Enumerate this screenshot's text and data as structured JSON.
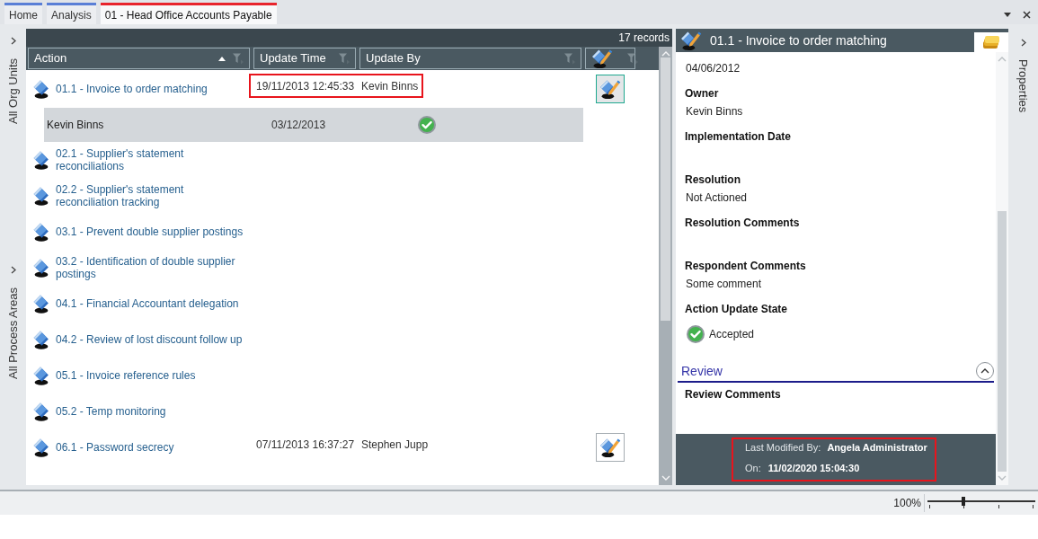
{
  "tabs": [
    {
      "label": "Home",
      "selected": false,
      "color": "#5a7fd6"
    },
    {
      "label": "Analysis",
      "selected": false,
      "color": "#5a7fd6"
    },
    {
      "label": "01 - Head Office Accounts Payable",
      "selected": true,
      "color": "#e8242c"
    }
  ],
  "left_panels": [
    {
      "label": "All Org Units"
    },
    {
      "label": "All Process Areas"
    }
  ],
  "grid": {
    "record_count": "17 records",
    "columns": [
      {
        "kind": "text",
        "label": "Action",
        "sorted": true
      },
      {
        "kind": "text",
        "label": "Update Time",
        "sorted": false
      },
      {
        "kind": "text",
        "label": "Update By",
        "sorted": false
      },
      {
        "kind": "icon",
        "sorted": false
      }
    ],
    "rows": [
      {
        "action": "01.1 - Invoice to order matching",
        "update_time": "19/11/2013 12:45:33",
        "update_by": "Kevin Binns",
        "highlighted": true,
        "edit": {
          "focused": true
        },
        "updates": [
          {
            "name": "Kevin Binns",
            "date": "03/12/2013",
            "accepted": true
          }
        ]
      },
      {
        "action": "02.1 - Supplier's statement reconciliations",
        "highlighted": false
      },
      {
        "action": "02.2 - Supplier's statement reconciliation tracking",
        "highlighted": false
      },
      {
        "action": "03.1 - Prevent double supplier postings",
        "highlighted": false
      },
      {
        "action": "03.2 - Identification of double supplier postings",
        "highlighted": false
      },
      {
        "action": "04.1 - Financial Accountant delegation",
        "highlighted": false
      },
      {
        "action": "04.2 - Review of lost discount follow up",
        "highlighted": false
      },
      {
        "action": "05.1 - Invoice reference rules",
        "highlighted": false
      },
      {
        "action": "05.2 - Temp monitoring",
        "highlighted": false
      },
      {
        "action": "06.1 - Password secrecy",
        "update_time": "07/11/2013 16:37:27",
        "update_by": "Stephen Jupp",
        "highlighted": false,
        "edit": {
          "focused": false
        }
      }
    ]
  },
  "detail": {
    "title": "01.1 - Invoice to order matching",
    "fields": [
      {
        "kind": "text",
        "value": "04/06/2012"
      },
      {
        "kind": "text",
        "label": "Owner",
        "value": "Kevin Binns"
      },
      {
        "kind": "text",
        "label": "Implementation Date"
      },
      {
        "kind": "text",
        "label": "Resolution",
        "value": "Not Actioned"
      },
      {
        "kind": "text",
        "label": "Resolution Comments"
      },
      {
        "kind": "text",
        "label": "Respondent Comments",
        "value": "Some comment"
      },
      {
        "kind": "status",
        "label": "Action Update State",
        "value": "Accepted",
        "accepted": true
      }
    ],
    "sections": [
      {
        "title": "Review",
        "expanded": true,
        "fields": [
          {
            "label": "Review Comments"
          }
        ]
      }
    ],
    "footer": {
      "highlighted": true,
      "modified_by_label": "Last Modified By:",
      "modified_by": "Angela Administrator",
      "on_label": "On:",
      "on": "11/02/2020 15:04:30"
    }
  },
  "right_panel": {
    "label": "Properties"
  },
  "status_bar": {
    "zoom": {
      "reading": "100%",
      "level": 0.33
    }
  }
}
